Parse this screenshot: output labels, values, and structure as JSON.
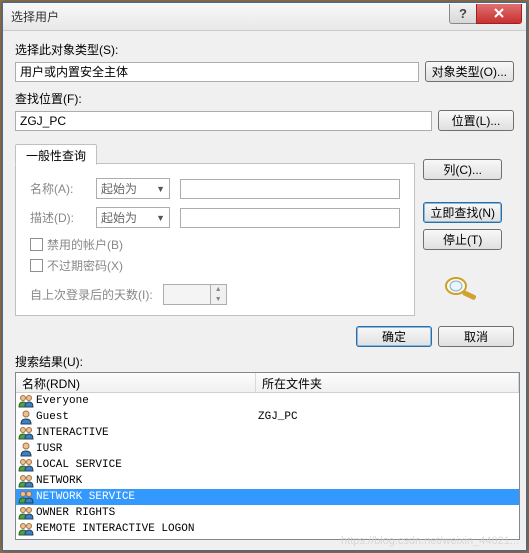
{
  "title": "选择用户",
  "objectType": {
    "label": "选择此对象类型(S):",
    "value": "用户或内置安全主体",
    "button": "对象类型(O)..."
  },
  "location": {
    "label": "查找位置(F):",
    "value": "ZGJ_PC",
    "button": "位置(L)..."
  },
  "tab": "一般性查询",
  "query": {
    "nameLabel": "名称(A):",
    "descLabel": "描述(D):",
    "startsWith": "起始为",
    "disabledAccounts": "禁用的帐户(B)",
    "nonExpiringPw": "不过期密码(X)",
    "daysLabel": "自上次登录后的天数(I):"
  },
  "sideButtons": {
    "columns": "列(C)...",
    "findNow": "立即查找(N)",
    "stop": "停止(T)"
  },
  "dlg": {
    "ok": "确定",
    "cancel": "取消"
  },
  "results": {
    "label": "搜索结果(U):",
    "col1": "名称(RDN)",
    "col2": "所在文件夹",
    "rows": [
      {
        "type": "group",
        "name": "Everyone",
        "folder": ""
      },
      {
        "type": "user",
        "name": "Guest",
        "folder": "ZGJ_PC"
      },
      {
        "type": "group",
        "name": "INTERACTIVE",
        "folder": ""
      },
      {
        "type": "user",
        "name": "IUSR",
        "folder": ""
      },
      {
        "type": "group",
        "name": "LOCAL SERVICE",
        "folder": ""
      },
      {
        "type": "group",
        "name": "NETWORK",
        "folder": ""
      },
      {
        "type": "group",
        "name": "NETWORK SERVICE",
        "folder": "",
        "selected": true
      },
      {
        "type": "group",
        "name": "OWNER RIGHTS",
        "folder": ""
      },
      {
        "type": "group",
        "name": "REMOTE INTERACTIVE LOGON",
        "folder": ""
      }
    ]
  },
  "watermark": "https://blog.csdn.net/weixin_44021..."
}
